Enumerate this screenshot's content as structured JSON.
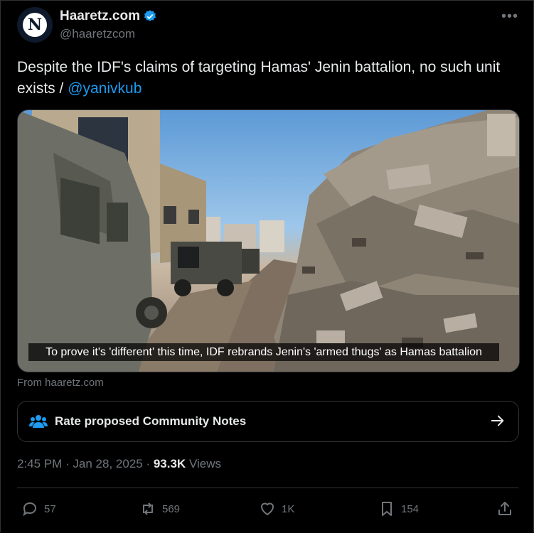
{
  "author": {
    "name": "Haaretz.com",
    "handle": "@haaretzcom",
    "avatar_letter": "N",
    "verified": true
  },
  "more_label": "•••",
  "tweet": {
    "text": "Despite the IDF's claims of targeting Hamas' Jenin battalion, no such unit exists / ",
    "mention": "@yanivkub"
  },
  "media": {
    "caption": "To prove it's 'different' this time, IDF rebrands Jenin's 'armed thugs' as Hamas battalion"
  },
  "link_source": "From haaretz.com",
  "community_notes": {
    "label": "Rate proposed Community Notes"
  },
  "meta": {
    "time_date": "2:45 PM · Jan 28, 2025 · ",
    "views_count": "93.3K",
    "views_label": " Views"
  },
  "actions": {
    "replies": "57",
    "reposts": "569",
    "likes": "1K",
    "bookmarks": "154"
  },
  "colors": {
    "background": "#000000",
    "text": "#e7e9ea",
    "muted": "#71767b",
    "accent": "#1d9bf0",
    "border": "#2f3336"
  }
}
